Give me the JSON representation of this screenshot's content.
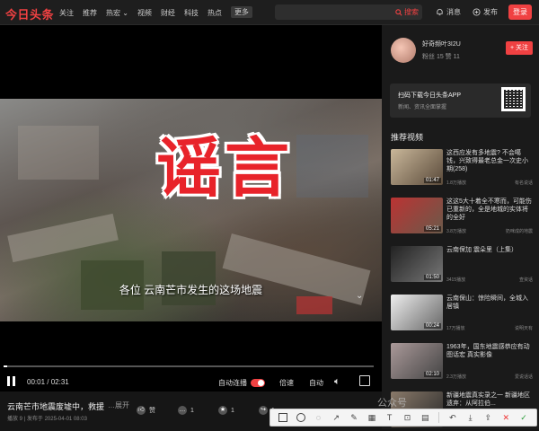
{
  "header": {
    "logo": "今日头条",
    "nav": [
      "关注",
      "推荐",
      "热宏 ⌄",
      "视频",
      "财经",
      "科技",
      "热点"
    ],
    "more": "更多",
    "search_placeholder": "",
    "search_button": "搜索",
    "messages": "消息",
    "publish": "发布",
    "login": "登录"
  },
  "video": {
    "overlay_text": "谣言",
    "subtitle": "各位 云南芒市发生的这场地震",
    "current_time": "00:01",
    "total_time": "02:31",
    "progress": 0.01,
    "autoplay_label": "自动连播",
    "speed_label": "倍速",
    "quality_label": "自动",
    "title": "云南芒市地震废墟中，救援",
    "title_more": "…展开",
    "meta": "播放 9 | 发布于 2025-04-01 08:03",
    "like_label": "赞",
    "comment_count": "1",
    "star_count": "1",
    "share_count": "1"
  },
  "sidebar": {
    "author_name": "好奇频叶3I2U",
    "author_stats": "粉丝 15    赞 11",
    "follow_label": "+ 关注",
    "app_title": "扫码下载今日头条APP",
    "app_sub": "新闻、资讯全面掌握",
    "rec_heading": "推荐视频",
    "recommendations": [
      {
        "title": "这西应发有多地震? 不会噶钱，兴致得最老总金一次史小期(258)",
        "views": "1.8万播放",
        "author": "有名说话",
        "duration": "01:47"
      },
      {
        "title": "这这5大十着全不寒而，可能伤已重新的，全是地城的实体将的全好",
        "views": "3.8万播放",
        "author": "奶咪成的地震",
        "duration": "05:21"
      },
      {
        "title": "云南保加 震朵里（上集）",
        "views": "3415播放",
        "author": "查资话",
        "duration": "01:50"
      },
      {
        "title": "云南保山：惊险瞬间，全城入居镇",
        "views": "17万播放",
        "author": "说明天有",
        "duration": "00:24"
      },
      {
        "title": "1963年，国东地震感恭应有动图话宏 真实影像",
        "views": "2.3万播放",
        "author": "爱说话话",
        "duration": "02:10"
      },
      {
        "title": "新疆地震真实录之一 新疆地区遗弃：从阿拉伯...",
        "views": "",
        "author": "",
        "duration": ""
      }
    ]
  },
  "watermark": "公众号",
  "colors": {
    "accent": "#f04142",
    "background": "#161616"
  }
}
